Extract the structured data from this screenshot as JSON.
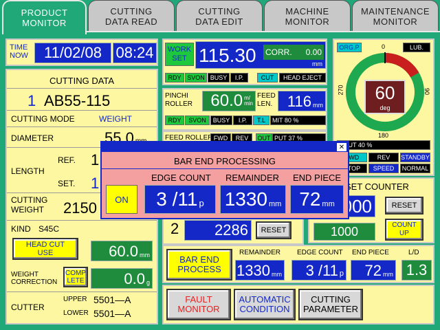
{
  "tabs": [
    {
      "label": "PRODUCT\nMONITOR"
    },
    {
      "label": "CUTTING\nDATA READ"
    },
    {
      "label": "CUTTING\nDATA EDIT"
    },
    {
      "label": "MACHINE\nMONITOR"
    },
    {
      "label": "MAINTENANCE\nMONITOR"
    }
  ],
  "time": {
    "label": "TIME\nNOW",
    "date": "11/02/08",
    "clock": "08:24"
  },
  "cutting_data": {
    "title": "CUTTING DATA",
    "item_no": "1",
    "item_code": "AB55-115",
    "mode_label": "CUTTING MODE",
    "mode_value": "WEIGHT",
    "diameter_label": "DIAMETER",
    "diameter_value": "55.0",
    "diameter_unit": "mm",
    "length_label": "LENGTH",
    "ref_label": "REF.",
    "ref_value": "1",
    "set_label": "SET.",
    "set_value": "1",
    "weight_label": "CUTTING\nWEIGHT",
    "weight_value": "2150",
    "kind_label": "KIND",
    "kind_value": "S45C",
    "head_cut_label": "HEAD CUT\nUSE",
    "head_cut_value": "60.0",
    "head_cut_unit": "mm",
    "weight_corr_label": "WEIGHT\nCORRECTION",
    "complete_label": "COMP\nLETE",
    "weight_corr_value": "0.0",
    "weight_corr_unit": "g",
    "cutter_label": "CUTTER",
    "upper_label": "UPPER",
    "upper_value": "5501—A",
    "lower_label": "LOWER",
    "lower_value": "5501—A"
  },
  "work": {
    "label": "WORK\nSET",
    "value": "115.30",
    "corr_label": "CORR.",
    "corr_value": "0.00",
    "unit": "mm",
    "indicators": [
      "RDY",
      "SVON",
      "BUSY",
      "I.P.",
      "CUT",
      "HEAD EJECT"
    ]
  },
  "pinch": {
    "label": "PINCHI\nROLLER",
    "value": "60.0",
    "unit": "m/\nmin",
    "feed_label": "FEED\nLEN.",
    "feed_value": "116",
    "feed_unit": "mm",
    "indicators": [
      "RDY",
      "SVON",
      "BUSY",
      "I.P.",
      "T.L"
    ],
    "limit_text": "MIT  80 %"
  },
  "feed_roller": {
    "label": "FEED ROLLER",
    "fwd": "FWD",
    "rev": "REV",
    "out": "OUT",
    "output_text": "PUT   37 %"
  },
  "dial": {
    "orgp": "ORG.P",
    "zero": "0",
    "lub": "LUB.",
    "value": "60",
    "unit": "deg",
    "l270": "270",
    "l90": "90",
    "l180": "180",
    "output_text": "TPUT  40 %",
    "level_deg": 60
  },
  "status": {
    "fwd": "FWD",
    "rev": "REV",
    "standby": "STANDBY",
    "stop": "STOP",
    "speed": "SPEED",
    "normal": "NORMAL"
  },
  "set_counter": {
    "title": "SET COUNTER",
    "value1": "000",
    "reset1": "RESET",
    "value2": "1000",
    "count_up": "COUNT\nUP"
  },
  "counter2": {
    "index": "2",
    "value": "2286",
    "reset": "RESET"
  },
  "bar_end": {
    "button": "BAR END\nPROCESS",
    "remainder_label": "REMAINDER",
    "remainder_value": "1330",
    "remainder_unit": "mm",
    "edge_label": "EDGE COUNT",
    "edge_value": "3 /11",
    "edge_unit": "p",
    "end_label": "END PIECE",
    "end_value": "72",
    "end_unit": "mm",
    "ld_label": "L/D",
    "ld_value": "1.3"
  },
  "bottom_buttons": {
    "fault": "FAULT\nMONITOR",
    "auto": "AUTOMATIC\nCONDITION",
    "param": "CUTTING\nPARAMETER"
  },
  "popup": {
    "title": "BAR END PROCESSING",
    "on": "ON",
    "edge_label": "EDGE COUNT",
    "edge_value": "3 /11",
    "edge_unit": "p",
    "remainder_label": "REMAINDER",
    "remainder_value": "1330",
    "remainder_unit": "mm",
    "end_label": "END PIECE",
    "end_value": "72",
    "end_unit": "mm",
    "close": "✕"
  },
  "colors": {
    "accent": "#1428c8",
    "bg": "#20a878",
    "panel": "#fcf7a0",
    "pink": "#f4a0a0"
  }
}
